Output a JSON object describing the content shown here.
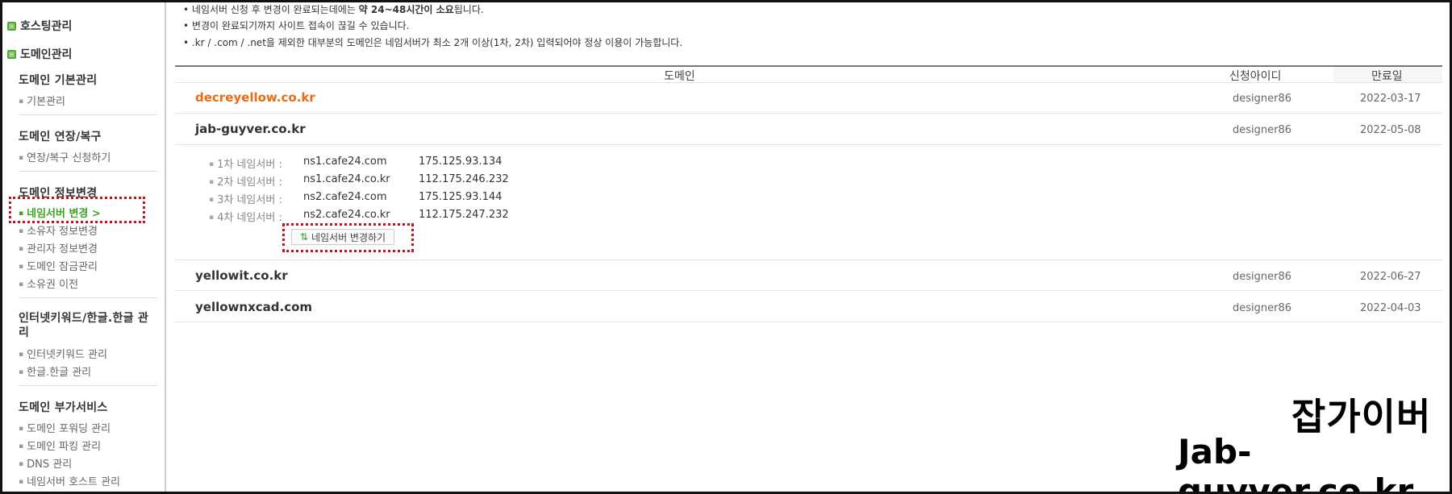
{
  "sidebar": {
    "top_items": [
      "호스팅관리",
      "도메인관리"
    ],
    "sections": [
      {
        "title": "도메인 기본관리",
        "items": [
          "기본관리"
        ]
      },
      {
        "title": "도메인 연장/복구",
        "items": [
          "연장/복구 신청하기"
        ]
      },
      {
        "title": "도메인 정보변경",
        "items": [
          "네임서버 변경 >",
          "소유자 정보변경",
          "관리자 정보변경",
          "도메인 잠금관리",
          "소유권 이전"
        ]
      },
      {
        "title": "인터넷키워드/한글.한글 관리",
        "items": [
          "인터넷키워드 관리",
          "한글.한글 관리"
        ]
      },
      {
        "title": "도메인 부가서비스",
        "items": [
          "도메인 포워딩 관리",
          "도메인 파킹 관리",
          "DNS 관리",
          "네임서버 호스트 관리"
        ]
      }
    ]
  },
  "notes": {
    "line1_pre": "네임서버 신청 후 변경이 완료되는데에는 ",
    "line1_bold": "약 24~48시간이 소요",
    "line1_post": "됩니다.",
    "line2": "변경이 완료되기까지 사이트 접속이 끊길 수 있습니다.",
    "line3": ".kr / .com / .net을 제외한 대부분의 도메인은 네임서버가 최소 2개 이상(1차, 2차) 입력되어야 정상 이용이 가능합니다."
  },
  "table": {
    "headers": {
      "domain": "도메인",
      "userid": "신청아이디",
      "expiry": "만료일"
    },
    "rows": [
      {
        "domain": "decreyellow.co.kr",
        "userid": "designer86",
        "expiry": "2022-03-17"
      },
      {
        "domain": "jab-guyver.co.kr",
        "userid": "designer86",
        "expiry": "2022-05-08"
      },
      {
        "domain": "yellowit.co.kr",
        "userid": "designer86",
        "expiry": "2022-06-27"
      },
      {
        "domain": "yellownxcad.com",
        "userid": "designer86",
        "expiry": "2022-04-03"
      }
    ],
    "nameservers": [
      {
        "label": "1차 네임서버 :",
        "host": "ns1.cafe24.com",
        "ip": "175.125.93.134"
      },
      {
        "label": "2차 네임서버 :",
        "host": "ns1.cafe24.co.kr",
        "ip": "112.175.246.232"
      },
      {
        "label": "3차 네임서버 :",
        "host": "ns2.cafe24.com",
        "ip": "175.125.93.144"
      },
      {
        "label": "4차 네임서버 :",
        "host": "ns2.cafe24.co.kr",
        "ip": "112.175.247.232"
      }
    ],
    "change_ns_button": "네임서버 변경하기"
  },
  "watermark": {
    "line1": "잡가이버",
    "line2": "Jab-guyver.co.kr"
  },
  "colors": {
    "accent_green": "#3fa126",
    "highlight_orange": "#e96b16",
    "annotation_red": "#c4141b"
  }
}
